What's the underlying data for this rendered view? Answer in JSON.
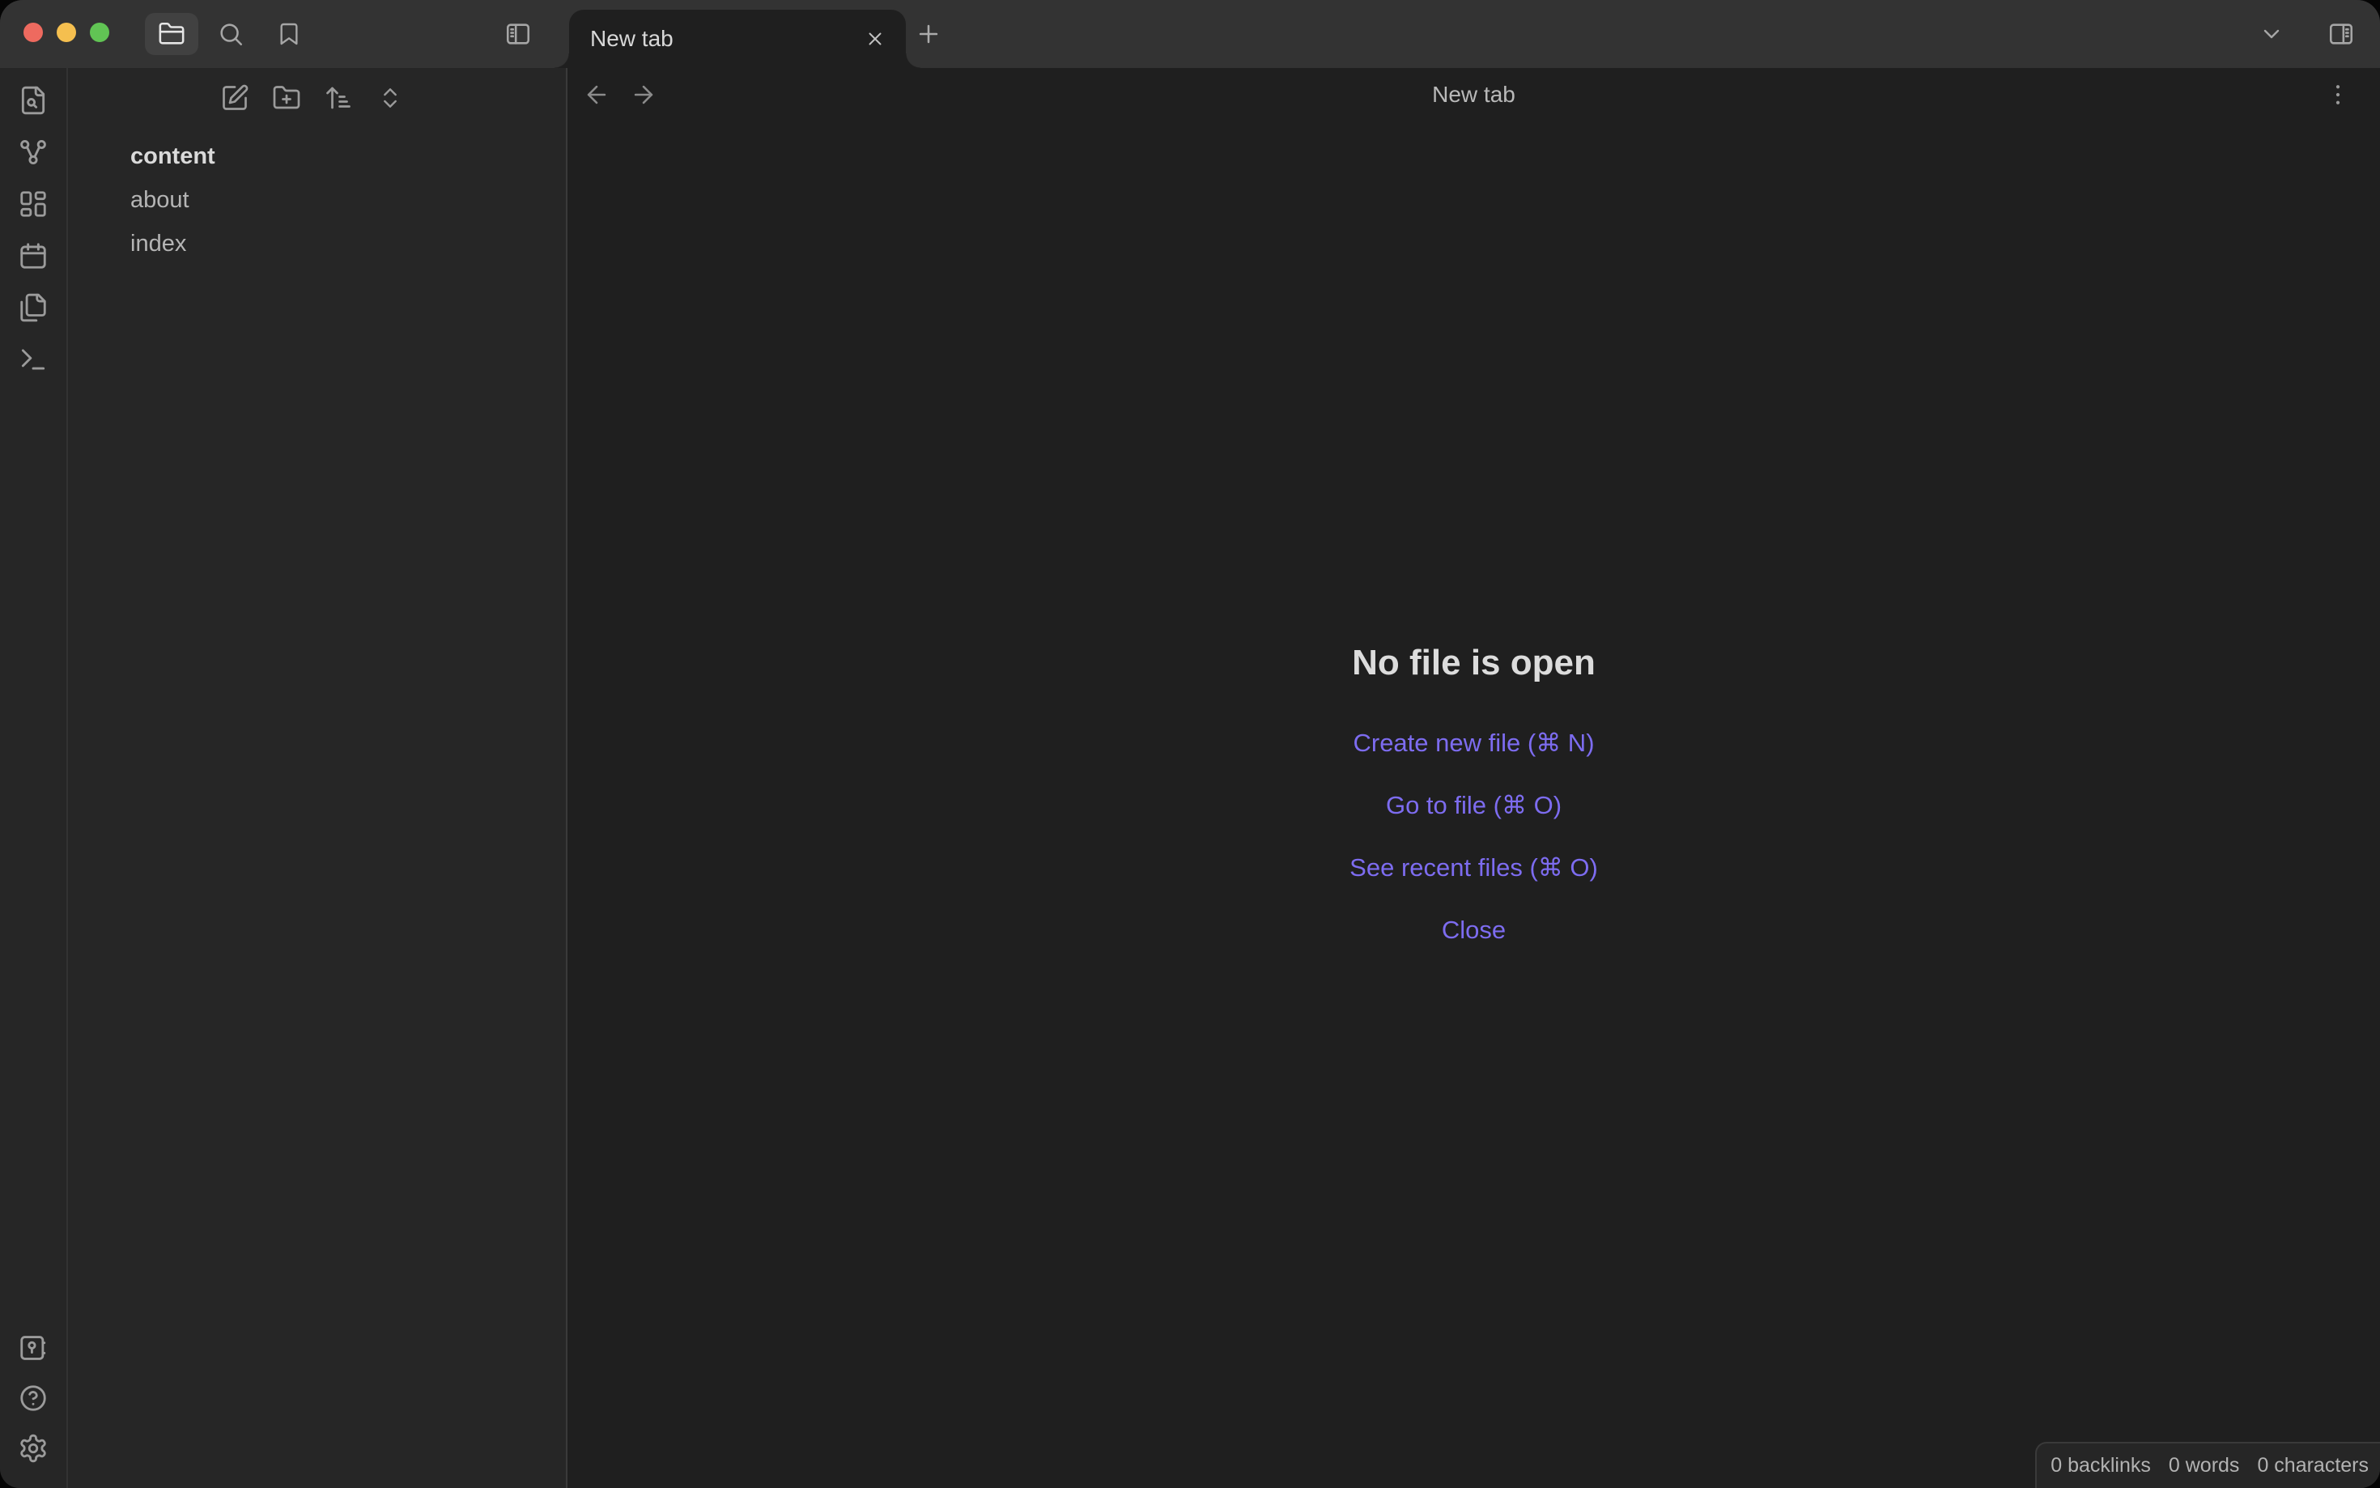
{
  "colors": {
    "accent": "#7d6cf0",
    "titlebar_bg": "#333333",
    "sidebar_bg": "#262626",
    "main_bg": "#1f1f1f",
    "border": "#3a3a3a",
    "text_light": "#dadada",
    "text_muted": "#9b9b9b",
    "traffic_red": "#ee6a5f",
    "traffic_yellow": "#f5bf4f",
    "traffic_green": "#61c454"
  },
  "titlebar": {
    "tab": {
      "title": "New tab"
    }
  },
  "icons": {
    "folder-icon": "folder outline",
    "search-icon": "magnifier",
    "bookmark-icon": "bookmark ribbon",
    "panel-left-icon": "toggle left sidebar",
    "panel-right-icon": "toggle right sidebar",
    "chevron-down-icon": "tab list dropdown",
    "plus-icon": "new tab",
    "close-icon": "close tab",
    "file-search-icon": "document with magnifier",
    "graph-icon": "three linked nodes",
    "canvas-icon": "dashboard tiles",
    "calendar-icon": "daily note calendar",
    "templates-icon": "stacked documents",
    "terminal-icon": "terminal prompt",
    "vault-icon": "vault safe",
    "help-icon": "question mark circle",
    "settings-icon": "gear",
    "new-note-icon": "square with pen",
    "new-folder-icon": "folder with plus",
    "sort-icon": "up arrow with lines",
    "collapse-icon": "chevrons up-down",
    "back-icon": "arrow left",
    "forward-icon": "arrow right",
    "more-icon": "vertical ellipsis"
  },
  "file_explorer": {
    "items": [
      {
        "name": "content",
        "type": "folder"
      },
      {
        "name": "about",
        "type": "file"
      },
      {
        "name": "index",
        "type": "file"
      }
    ]
  },
  "main": {
    "header_title": "New tab",
    "empty_state": {
      "heading": "No file is open",
      "actions": [
        {
          "label": "Create new file (⌘ N)"
        },
        {
          "label": "Go to file (⌘ O)"
        },
        {
          "label": "See recent files (⌘ O)"
        },
        {
          "label": "Close"
        }
      ]
    }
  },
  "status_bar": {
    "backlinks": "0 backlinks",
    "words": "0 words",
    "characters": "0 characters"
  }
}
